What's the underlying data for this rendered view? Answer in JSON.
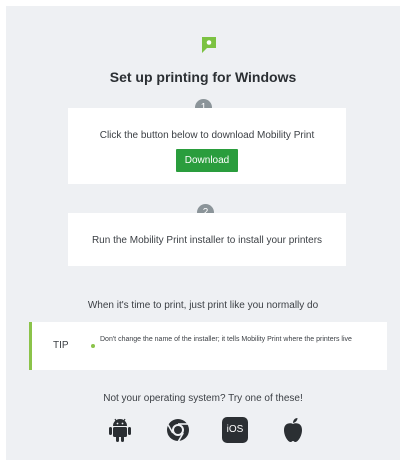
{
  "header": {
    "title": "Set up printing for Windows"
  },
  "step1": {
    "number": "1",
    "text": "Click the button below to download Mobility Print",
    "button_label": "Download"
  },
  "step2": {
    "number": "2",
    "text": "Run the Mobility Print installer to install your printers"
  },
  "print_note": "When it's time to print, just print like you normally do",
  "tip": {
    "label": "TIP",
    "text": "Don't change the name of the installer; it tells Mobility Print where the printers live"
  },
  "os_prompt": "Not your operating system? Try one of these!",
  "os_icons": [
    "android-icon",
    "chrome-icon",
    "ios-icon",
    "apple-icon"
  ],
  "os_ios_label": "iOS",
  "colors": {
    "accent": "#2a9d3d",
    "tip_accent": "#8bc34a",
    "badge": "#8b9499",
    "icon": "#2b2f33"
  }
}
